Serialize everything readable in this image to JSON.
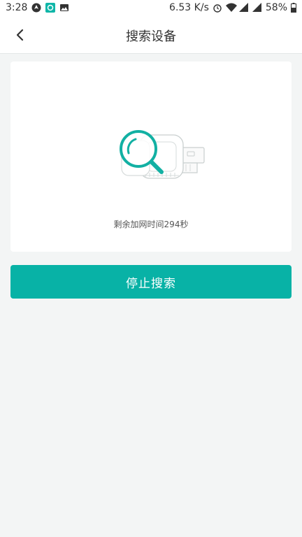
{
  "status_bar": {
    "time": "3:28",
    "network_speed": "6.53 K/s",
    "battery": "58%"
  },
  "header": {
    "title": "搜索设备"
  },
  "search_card": {
    "remaining_text": "剩余加网时间294秒"
  },
  "actions": {
    "stop_label": "停止搜索"
  },
  "colors": {
    "accent": "#08b2a6",
    "background": "#f3f5f5"
  }
}
